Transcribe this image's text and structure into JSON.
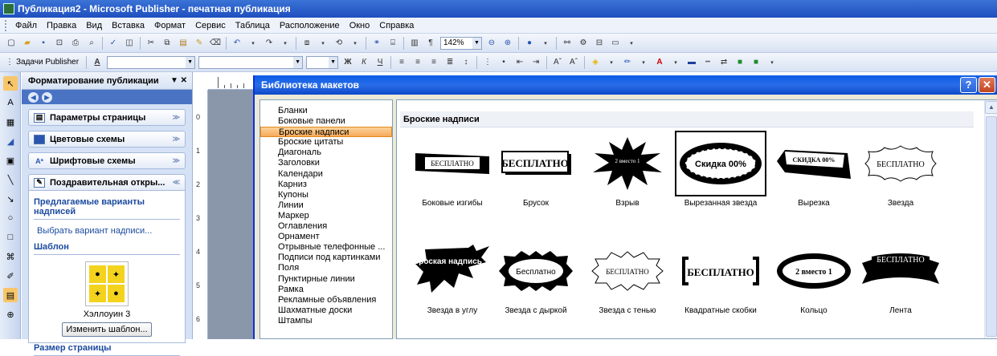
{
  "window": {
    "title": "Публикация2 - Microsoft Publisher - печатная публикация"
  },
  "menu": [
    "Файл",
    "Правка",
    "Вид",
    "Вставка",
    "Формат",
    "Сервис",
    "Таблица",
    "Расположение",
    "Окно",
    "Справка"
  ],
  "toolbar": {
    "zoom": "142%",
    "tasks_label": "Задачи Publisher"
  },
  "taskpane": {
    "title": "Форматирование публикации",
    "sections": [
      "Параметры страницы",
      "Цветовые схемы",
      "Шрифтовые схемы",
      "Поздравительная откры..."
    ],
    "suggested_heading": "Предлагаемые варианты надписей",
    "choose_link": "Выбрать вариант надписи...",
    "template_heading": "Шаблон",
    "template_name": "Хэллоуин 3",
    "change_button": "Изменить шаблон...",
    "page_size_heading": "Размер страницы"
  },
  "ruler": {
    "numbers": [
      "0",
      "1",
      "2",
      "3",
      "4",
      "5",
      "6"
    ]
  },
  "dialog": {
    "title": "Библиотека макетов",
    "categories": [
      "Бланки",
      "Боковые панели",
      "Броские надписи",
      "Броские цитаты",
      "Диагональ",
      "Заголовки",
      "Календари",
      "Карниз",
      "Купоны",
      "Линии",
      "Маркер",
      "Оглавления",
      "Орнамент",
      "Отрывные телефонные ...",
      "Подписи под картинками",
      "Поля",
      "Пунктирные линии",
      "Рамка",
      "Рекламные объявления",
      "Шахматные доски",
      "Штампы"
    ],
    "selected_category": "Броские надписи",
    "section_header": "Броские надписи",
    "items": [
      {
        "label": "Боковые изгибы",
        "art_text": "БЕСПЛАТНО"
      },
      {
        "label": "Брусок",
        "art_text": "БЕСПЛАТНО"
      },
      {
        "label": "Взрыв",
        "art_text": "2 вместо 1"
      },
      {
        "label": "Вырезанная звезда",
        "art_text": "Скидка 00%"
      },
      {
        "label": "Вырезка",
        "art_text": "СКИДКА 00%"
      },
      {
        "label": "Звезда",
        "art_text": "БЕСПЛАТНО"
      },
      {
        "label": "Звезда в углу",
        "art_text": "Броская надпись"
      },
      {
        "label": "Звезда с дыркой",
        "art_text": "Бесплатно"
      },
      {
        "label": "Звезда с тенью",
        "art_text": "БЕСПЛАТНО"
      },
      {
        "label": "Квадратные скобки",
        "art_text": "БЕСПЛАТНО"
      },
      {
        "label": "Кольцо",
        "art_text": "2 вместо 1"
      },
      {
        "label": "Лента",
        "art_text": "БЕСПЛАТНО"
      }
    ]
  }
}
